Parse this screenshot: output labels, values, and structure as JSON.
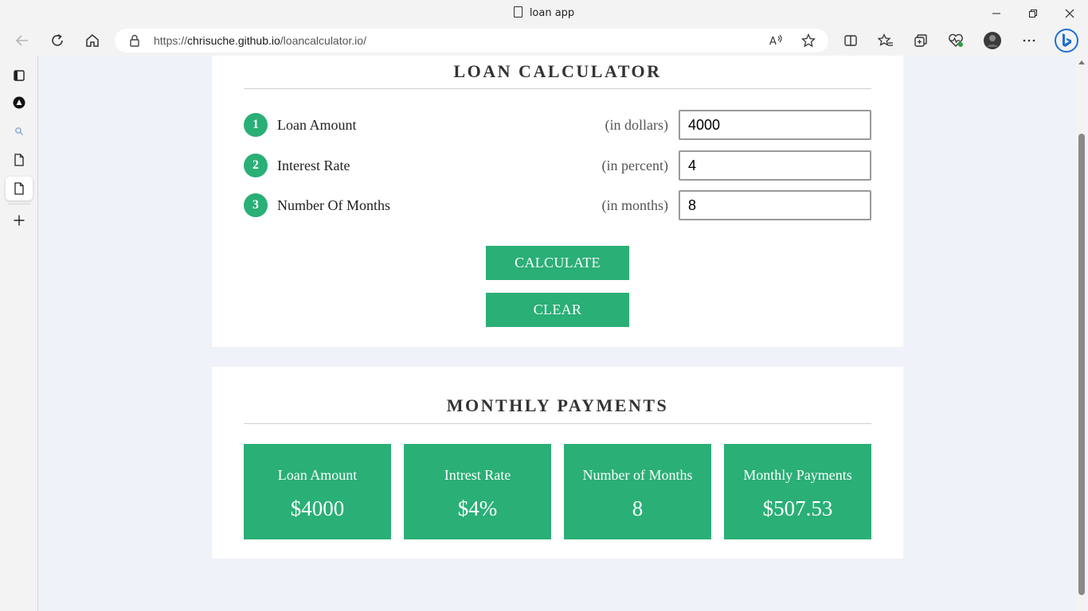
{
  "browser": {
    "tab_title": "loan app",
    "url_prefix": "https://",
    "url_host": "chrisuche.github.io",
    "url_path": "/loancalculator.io/"
  },
  "calculator": {
    "title": "LOAN CALCULATOR",
    "fields": [
      {
        "number": "1",
        "label": "Loan Amount",
        "unit": "(in dollars)",
        "value": "4000"
      },
      {
        "number": "2",
        "label": "Interest Rate",
        "unit": "(in percent)",
        "value": "4"
      },
      {
        "number": "3",
        "label": "Number Of Months",
        "unit": "(in months)",
        "value": "8"
      }
    ],
    "calculate_label": "CALCULATE",
    "clear_label": "CLEAR"
  },
  "payments": {
    "title": "MONTHLY PAYMENTS",
    "cards": [
      {
        "label": "Loan Amount",
        "value": "$4000"
      },
      {
        "label": "Intrest Rate",
        "value": "$4%"
      },
      {
        "label": "Number of Months",
        "value": "8"
      },
      {
        "label": "Monthly Payments",
        "value": "$507.53"
      }
    ]
  },
  "colors": {
    "accent": "#2aaf76",
    "page_bg": "#f0f2f9"
  }
}
